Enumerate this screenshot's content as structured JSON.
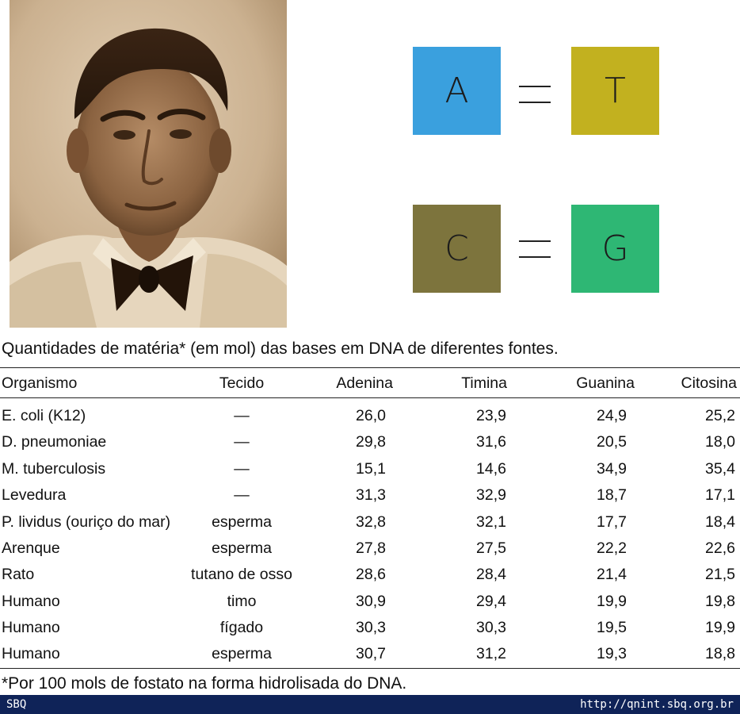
{
  "pairs": {
    "row1": {
      "left": {
        "letter": "A",
        "color": "#3aa0de"
      },
      "right": {
        "letter": "T",
        "color": "#c2b11f"
      }
    },
    "row2": {
      "left": {
        "letter": "C",
        "color": "#7d743d"
      },
      "right": {
        "letter": "G",
        "color": "#2eb774"
      }
    }
  },
  "caption": "Quantidades de matéria*  (em mol) das bases em DNA de diferentes fontes.",
  "table": {
    "headers": {
      "organismo": "Organismo",
      "tecido": "Tecido",
      "adenina": "Adenina",
      "timina": "Timina",
      "guanina": "Guanina",
      "citosina": "Citosina"
    },
    "rows": [
      {
        "organismo": "E. coli (K12)",
        "tecido": "—",
        "adenina": "26,0",
        "timina": "23,9",
        "guanina": "24,9",
        "citosina": "25,2"
      },
      {
        "organismo": "D. pneumoniae",
        "tecido": "—",
        "adenina": "29,8",
        "timina": "31,6",
        "guanina": "20,5",
        "citosina": "18,0"
      },
      {
        "organismo": "M. tuberculosis",
        "tecido": "—",
        "adenina": "15,1",
        "timina": "14,6",
        "guanina": "34,9",
        "citosina": "35,4"
      },
      {
        "organismo": "Levedura",
        "tecido": "—",
        "adenina": "31,3",
        "timina": "32,9",
        "guanina": "18,7",
        "citosina": "17,1"
      },
      {
        "organismo": "P. lividus (ouriço do mar)",
        "tecido": "esperma",
        "adenina": "32,8",
        "timina": "32,1",
        "guanina": "17,7",
        "citosina": "18,4"
      },
      {
        "organismo": "Arenque",
        "tecido": "esperma",
        "adenina": "27,8",
        "timina": "27,5",
        "guanina": "22,2",
        "citosina": "22,6"
      },
      {
        "organismo": "Rato",
        "tecido": "tutano de osso",
        "adenina": "28,6",
        "timina": "28,4",
        "guanina": "21,4",
        "citosina": "21,5"
      },
      {
        "organismo": "Humano",
        "tecido": "timo",
        "adenina": "30,9",
        "timina": "29,4",
        "guanina": "19,9",
        "citosina": "19,8"
      },
      {
        "organismo": "Humano",
        "tecido": "fígado",
        "adenina": "30,3",
        "timina": "30,3",
        "guanina": "19,5",
        "citosina": "19,9"
      },
      {
        "organismo": "Humano",
        "tecido": "esperma",
        "adenina": "30,7",
        "timina": "31,2",
        "guanina": "19,3",
        "citosina": "18,8"
      }
    ]
  },
  "footnote": "*Por 100 mols de fostato na  forma hidrolisada do DNA.",
  "footer": {
    "left": "SBQ",
    "right": "http://qnint.sbq.org.br",
    "color": "#0f2358"
  }
}
